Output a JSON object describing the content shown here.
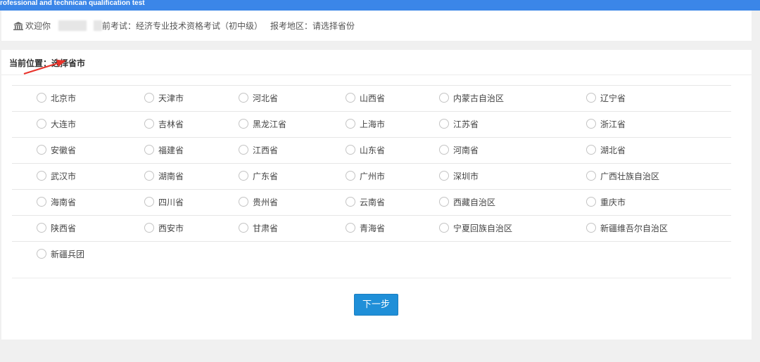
{
  "header": {
    "tagline": "rofessional and technican qualification test"
  },
  "infobar": {
    "home_icon": "home-icon",
    "welcome": "欢迎你",
    "exam": "前考试：经济专业技术资格考试（初中级）",
    "region": "报考地区：请选择省份"
  },
  "breadcrumb": {
    "text": "当前位置：选择省市"
  },
  "provinces": [
    [
      "北京市",
      "天津市",
      "河北省",
      "山西省",
      "内蒙古自治区",
      "辽宁省"
    ],
    [
      "大连市",
      "吉林省",
      "黑龙江省",
      "上海市",
      "江苏省",
      "浙江省"
    ],
    [
      "安徽省",
      "福建省",
      "江西省",
      "山东省",
      "河南省",
      "湖北省"
    ],
    [
      "武汉市",
      "湖南省",
      "广东省",
      "广州市",
      "深圳市",
      "广西壮族自治区"
    ],
    [
      "海南省",
      "四川省",
      "贵州省",
      "云南省",
      "西藏自治区",
      "重庆市"
    ],
    [
      "陕西省",
      "西安市",
      "甘肃省",
      "青海省",
      "宁夏回族自治区",
      "新疆维吾尔自治区"
    ],
    [
      "新疆兵团"
    ]
  ],
  "actions": {
    "next_label": "下一步"
  },
  "colors": {
    "topbar": "#3b86e8",
    "button": "#1f8fd8",
    "arrow": "#e8322a"
  }
}
